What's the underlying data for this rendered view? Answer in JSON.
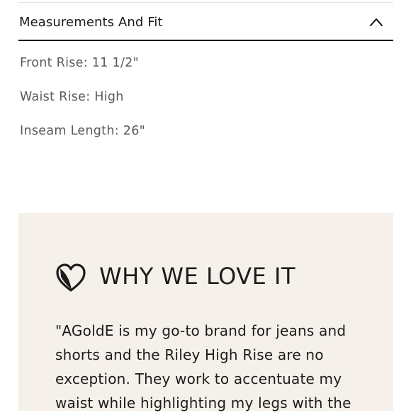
{
  "measurements": {
    "title": "Measurements And Fit",
    "expanded": true,
    "items": [
      "Front Rise: 11 1/2\"",
      "Waist Rise: High",
      "Inseam Length: 26\""
    ]
  },
  "love_section": {
    "title": "WHY WE LOVE IT",
    "quote": "\"AGoldE is my go-to brand for jeans and shorts and the Riley High Rise are no exception. They work to accentuate my waist while highlighting my legs with the",
    "background_color": "#f5f1ea"
  },
  "icons": {
    "toggle": "chevron-up-icon",
    "love": "heart-icon"
  }
}
